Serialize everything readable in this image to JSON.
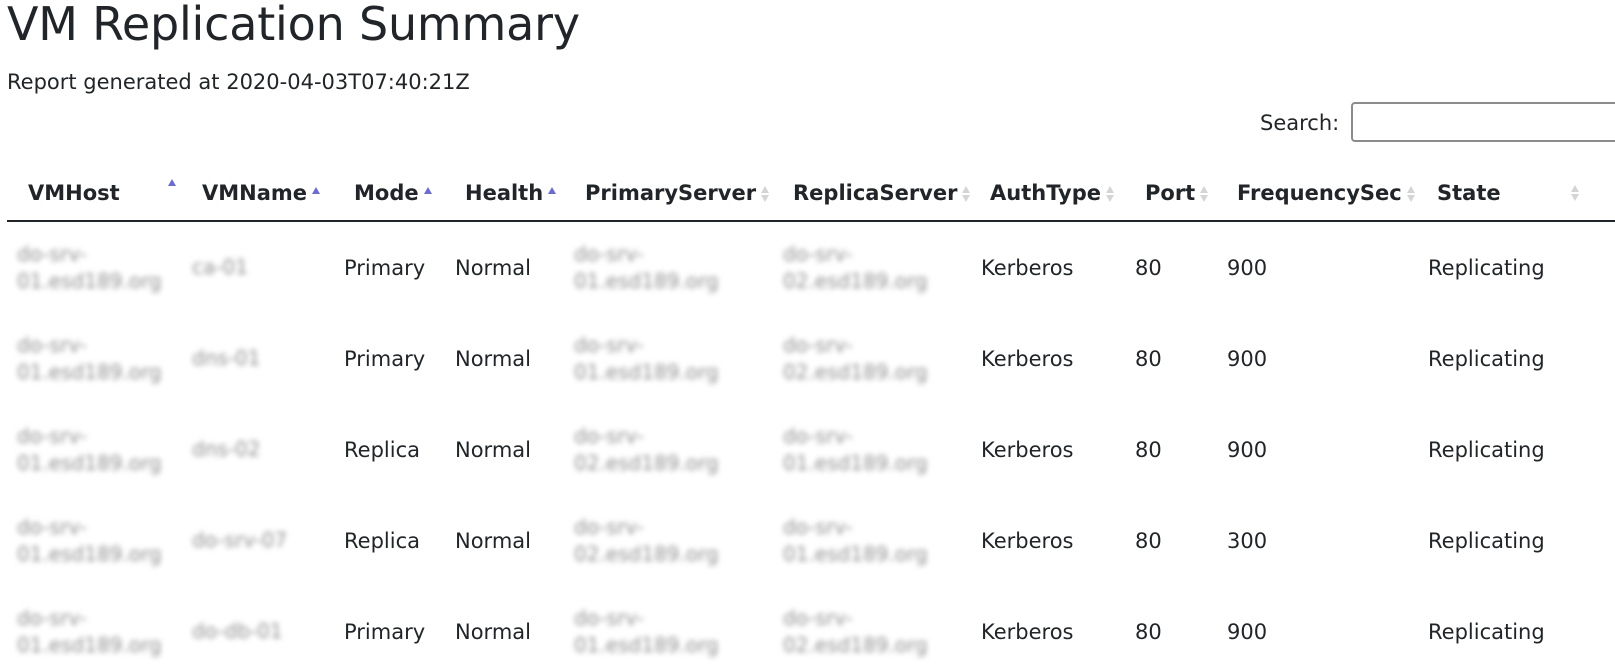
{
  "header": {
    "title": "VM Replication Summary",
    "generated": "Report generated at 2020-04-03T07:40:21Z"
  },
  "search": {
    "label": "Search:",
    "value": ""
  },
  "table": {
    "columns": [
      "VMHost",
      "VMName",
      "Mode",
      "Health",
      "PrimaryServer",
      "ReplicaServer",
      "AuthType",
      "Port",
      "FrequencySec",
      "State"
    ],
    "sorted_columns": [
      "VMHost",
      "VMName",
      "Mode",
      "Health"
    ],
    "rows": [
      {
        "vmhost": [
          "do-srv-",
          "01.esd189.org"
        ],
        "vmname": [
          "ca-01"
        ],
        "mode": "Primary",
        "health": "Normal",
        "primary": [
          "do-srv-",
          "01.esd189.org"
        ],
        "replica": [
          "do-srv-",
          "02.esd189.org"
        ],
        "auth": "Kerberos",
        "port": "80",
        "freq": "900",
        "state": "Replicating"
      },
      {
        "vmhost": [
          "do-srv-",
          "01.esd189.org"
        ],
        "vmname": [
          "dns-01"
        ],
        "mode": "Primary",
        "health": "Normal",
        "primary": [
          "do-srv-",
          "01.esd189.org"
        ],
        "replica": [
          "do-srv-",
          "02.esd189.org"
        ],
        "auth": "Kerberos",
        "port": "80",
        "freq": "900",
        "state": "Replicating"
      },
      {
        "vmhost": [
          "do-srv-",
          "01.esd189.org"
        ],
        "vmname": [
          "dns-02"
        ],
        "mode": "Replica",
        "health": "Normal",
        "primary": [
          "do-srv-",
          "02.esd189.org"
        ],
        "replica": [
          "do-srv-",
          "01.esd189.org"
        ],
        "auth": "Kerberos",
        "port": "80",
        "freq": "900",
        "state": "Replicating"
      },
      {
        "vmhost": [
          "do-srv-",
          "01.esd189.org"
        ],
        "vmname": [
          "do-srv-07"
        ],
        "mode": "Replica",
        "health": "Normal",
        "primary": [
          "do-srv-",
          "02.esd189.org"
        ],
        "replica": [
          "do-srv-",
          "01.esd189.org"
        ],
        "auth": "Kerberos",
        "port": "80",
        "freq": "300",
        "state": "Replicating"
      },
      {
        "vmhost": [
          "do-srv-",
          "01.esd189.org"
        ],
        "vmname": [
          "do-db-01"
        ],
        "mode": "Primary",
        "health": "Normal",
        "primary": [
          "do-srv-",
          "01.esd189.org"
        ],
        "replica": [
          "do-srv-",
          "02.esd189.org"
        ],
        "auth": "Kerberos",
        "port": "80",
        "freq": "900",
        "state": "Replicating"
      }
    ]
  }
}
